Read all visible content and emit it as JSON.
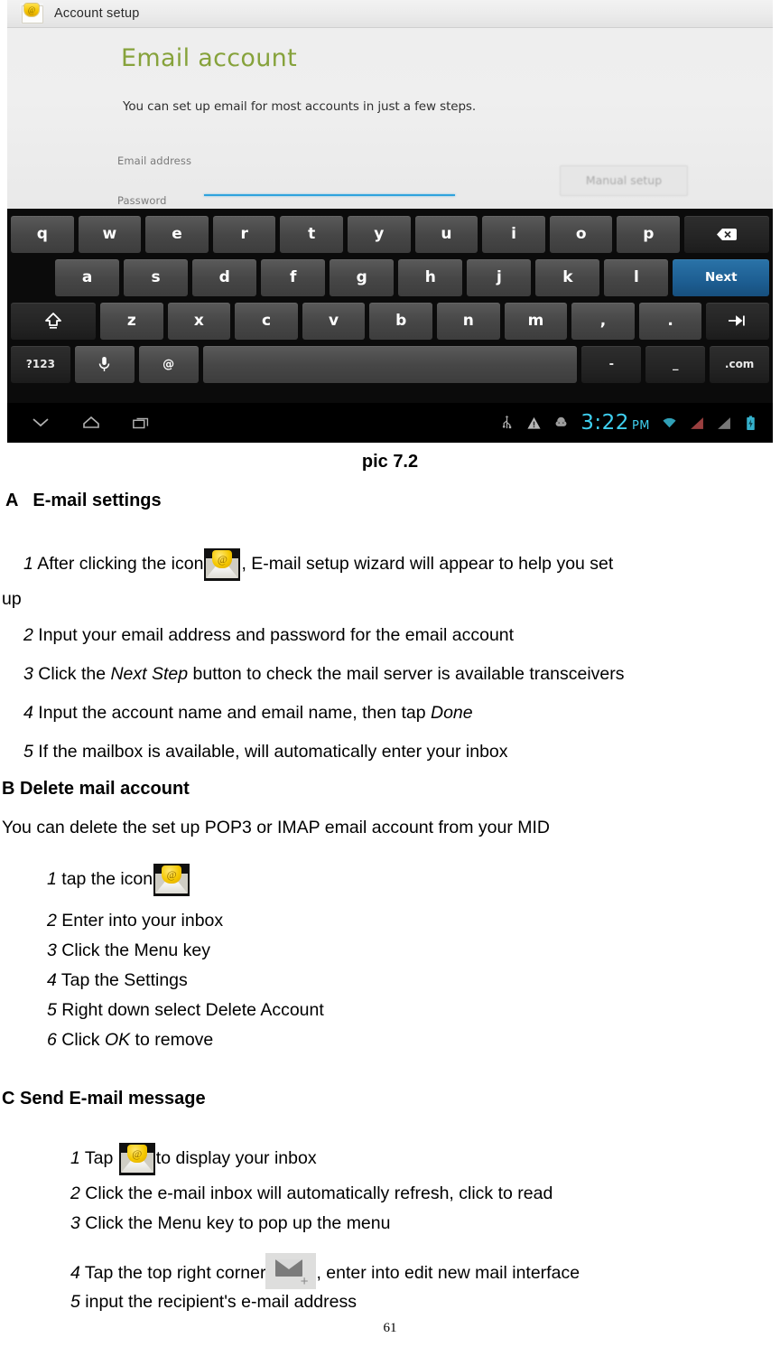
{
  "screenshot": {
    "titlebar": {
      "app_icon": "email-at-envelope-icon",
      "title": "Account setup"
    },
    "setup": {
      "heading": "Email account",
      "subtitle": "You can set up email for most accounts in just a few steps.",
      "email_label": "Email address",
      "email_value": "",
      "password_label": "Password",
      "password_value": "",
      "manual_setup_label": "Manual setup"
    },
    "keyboard": {
      "row1": [
        "q",
        "w",
        "e",
        "r",
        "t",
        "y",
        "u",
        "i",
        "o",
        "p"
      ],
      "row1_action": "backspace-key",
      "row2": [
        "a",
        "s",
        "d",
        "f",
        "g",
        "h",
        "j",
        "k",
        "l"
      ],
      "row2_action_label": "Next",
      "row3_shift": "shift-key",
      "row3": [
        "z",
        "x",
        "c",
        "v",
        "b",
        "n",
        "m",
        ",",
        "."
      ],
      "row3_action": "tab-key",
      "row4_symbols_label": "?123",
      "row4_mic": "microphone-key",
      "row4_at_label": "@",
      "row4_space": "",
      "row4_dash_label": "-",
      "row4_underscore_label": "_",
      "row4_dotcom_label": ".com"
    },
    "navbar": {
      "back": "back-nav-icon",
      "home": "home-nav-icon",
      "recents": "recent-apps-nav-icon",
      "usb": "usb-status-icon",
      "warning": "warning-status-icon",
      "debug": "android-debug-status-icon",
      "clock": "3:22",
      "ampm": "PM",
      "wifi": "wifi-status-icon",
      "signal1": "signal-status-icon-1",
      "signal2": "signal-status-icon-2",
      "battery": "battery-charging-status-icon"
    },
    "clock_color": "#3fd0f0",
    "accent_key_color": "#1d5e92",
    "heading_color": "#7e9c2c",
    "field_underline_color": "#2fa3dd"
  },
  "document": {
    "caption": "pic 7.2",
    "sections": [
      {
        "heading": "A   E-mail settings",
        "lines": [
          {
            "num": "1",
            "pre": " After clicking the icon",
            "icon": "mail-icon",
            "post": ", E-mail setup wizard will appear to help you set"
          },
          {
            "plain": "up"
          },
          {
            "num": "2",
            "pre": " Input your email address and password for the email account"
          },
          {
            "num": "3",
            "pre": " Click the ",
            "italic": "Next Step",
            "post": " button to check the mail server is available transceivers"
          },
          {
            "num": "4",
            "pre": " Input the account name and email name, then tap ",
            "italic": "Done",
            "post": ""
          },
          {
            "num": "5",
            "pre": " If the mailbox is available, will automatically enter your inbox"
          }
        ]
      },
      {
        "heading": "B Delete mail account",
        "intro": "You can delete the set up POP3 or IMAP email account from your MID",
        "lines": [
          {
            "num": "1",
            "pre": " tap the icon",
            "icon": "mail-icon",
            "post": ""
          },
          {
            "num": "2",
            "pre": " Enter into your inbox"
          },
          {
            "num": "3",
            "pre": " Click the Menu key"
          },
          {
            "num": "4",
            "pre": " Tap the Settings"
          },
          {
            "num": "5",
            "pre": " Right down select Delete Account"
          },
          {
            "num": "6",
            "pre": " Click ",
            "italic": "OK",
            "post": " to remove"
          }
        ]
      },
      {
        "heading": "C Send E-mail message",
        "lines": [
          {
            "num": "1",
            "pre": " Tap ",
            "icon": "mail-icon",
            "post": "to display your inbox"
          },
          {
            "num": "2",
            "pre": " Click the e-mail inbox will automatically refresh, click to read"
          },
          {
            "num": "3",
            "pre": " Click the Menu key to pop up the menu"
          },
          {
            "num": "4",
            "pre": " Tap the top right corner",
            "icon": "new-mail-icon",
            "post": ", enter into edit new mail interface"
          },
          {
            "num": "5",
            "pre": " input the recipient's e-mail address"
          }
        ]
      }
    ],
    "page_number": "61"
  }
}
